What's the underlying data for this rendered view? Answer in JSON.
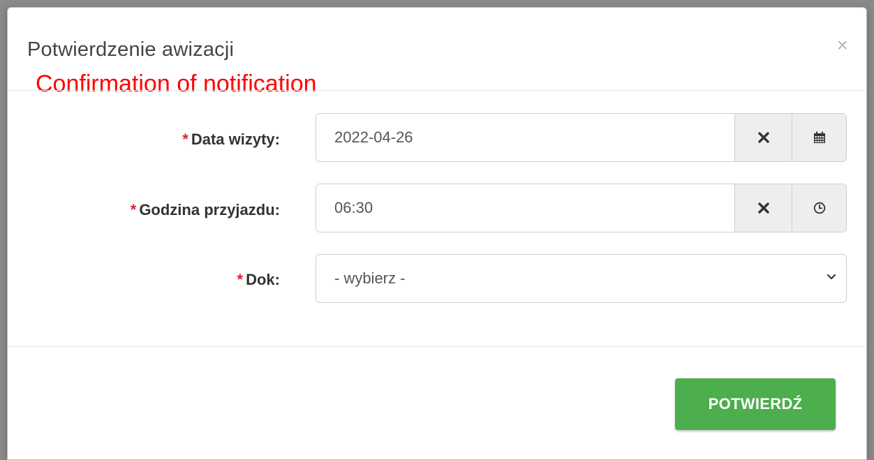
{
  "modal": {
    "title": "Potwierdzenie awizacji",
    "subtitle": "Confirmation of notification",
    "close_glyph": "×"
  },
  "form": {
    "required_mark": "*",
    "visit_date": {
      "label": "Data wizyty:",
      "value": "2022-04-26",
      "clear_icon": "x-mark-icon",
      "picker_icon": "calendar-icon"
    },
    "arrival_time": {
      "label": "Godzina przyjazdu:",
      "value": "06:30",
      "clear_icon": "x-mark-icon",
      "picker_icon": "clock-icon"
    },
    "dock": {
      "label": "Dok:",
      "selected": "- wybierz -"
    }
  },
  "footer": {
    "confirm_label": "POTWIERDŹ"
  },
  "colors": {
    "confirm_button": "#4cae4c",
    "required_star": "#d9232d",
    "subtitle": "#ff0000"
  }
}
